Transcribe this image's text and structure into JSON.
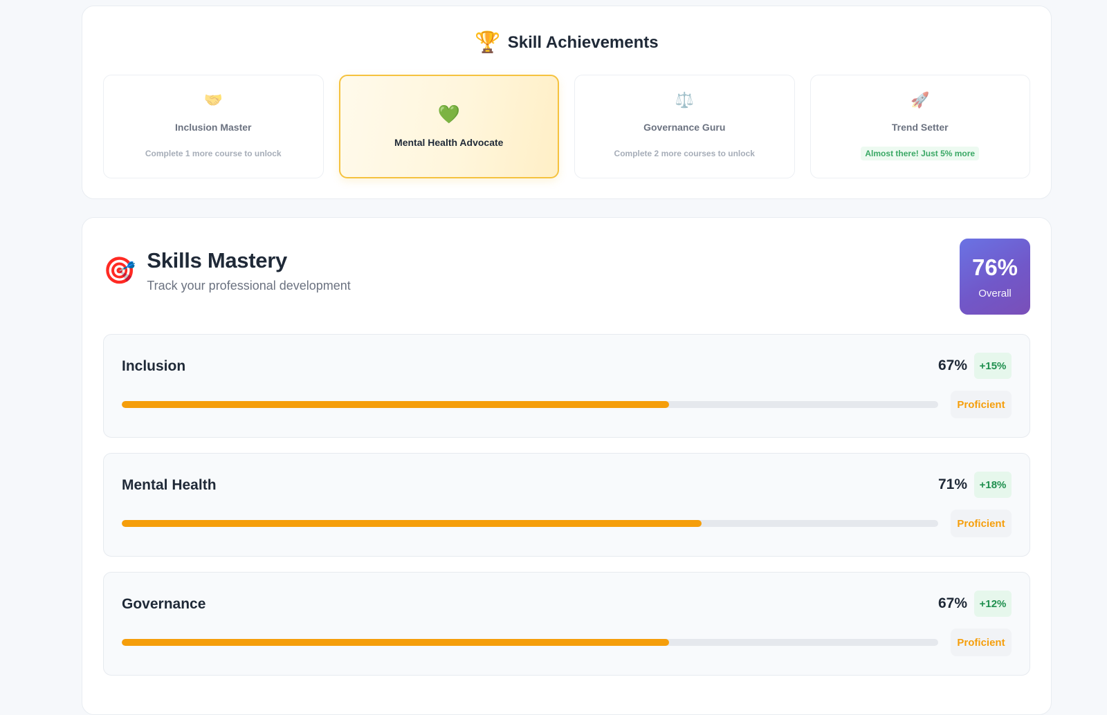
{
  "achievements": {
    "title": "Skill Achievements",
    "icon": "trophy-icon",
    "badges": [
      {
        "icon": "🤝",
        "icon_name": "handshake-icon",
        "name": "Inclusion Master",
        "hint": "Complete 1 more course to unlock",
        "state": "locked"
      },
      {
        "icon": "💚",
        "icon_name": "green-heart-icon",
        "name": "Mental Health Advocate",
        "hint": "",
        "state": "unlocked"
      },
      {
        "icon": "⚖️",
        "icon_name": "scales-icon",
        "name": "Governance Guru",
        "hint": "Complete 2 more courses to unlock",
        "state": "locked"
      },
      {
        "icon": "🚀",
        "icon_name": "rocket-icon",
        "name": "Trend Setter",
        "hint": "Almost there! Just 5% more",
        "state": "almost"
      }
    ]
  },
  "skills": {
    "title": "Skills Mastery",
    "subtitle": "Track your professional development",
    "icon": "dart-target-icon",
    "overall": {
      "value": "76%",
      "label": "Overall"
    },
    "items": [
      {
        "name": "Inclusion",
        "percent_label": "67%",
        "progress": 67,
        "delta": "+15%",
        "level": "Proficient"
      },
      {
        "name": "Mental Health",
        "percent_label": "71%",
        "progress": 71,
        "delta": "+18%",
        "level": "Proficient"
      },
      {
        "name": "Governance",
        "percent_label": "67%",
        "progress": 67,
        "delta": "+12%",
        "level": "Proficient"
      }
    ]
  },
  "colors": {
    "accent_progress": "#f59e0b",
    "delta_green": "#1f8f4e",
    "overall_gradient": [
      "#6a73e4",
      "#7a4fb8"
    ],
    "active_badge_border": "#f5c23e"
  }
}
